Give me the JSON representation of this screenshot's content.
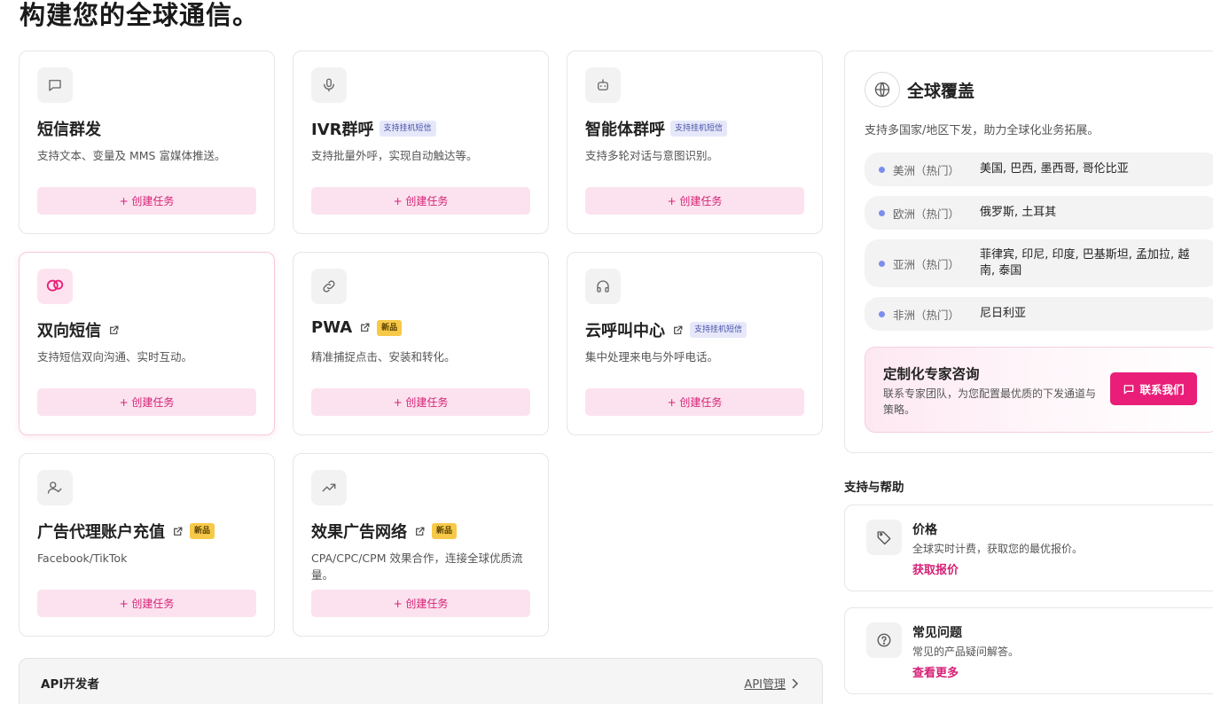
{
  "page": {
    "title": "构建您的全球通信。"
  },
  "colors": {
    "accent": "#e91e78",
    "accent_soft": "#fce2ee",
    "tag_blue_bg": "#e6e8fa",
    "tag_yellow_bg": "#f7c948",
    "region_dot": "#7b8ef0"
  },
  "services": [
    {
      "title": "短信群发",
      "icon": "chat-bubble-icon",
      "tag": "",
      "external": false,
      "desc": "支持文本、变量及 MMS 富媒体推送。",
      "button": "+ 创建任务"
    },
    {
      "title": "IVR群呼",
      "icon": "microphone-icon",
      "tag": "支持挂机短信",
      "external": false,
      "desc": "支持批量外呼，实现自动触达等。",
      "button": "+ 创建任务"
    },
    {
      "title": "智能体群呼",
      "icon": "robot-icon",
      "tag": "支持挂机短信",
      "external": false,
      "desc": "支持多轮对话与意图识别。",
      "button": "+ 创建任务"
    },
    {
      "title": "双向短信",
      "icon": "two-way-chat-icon",
      "tag": "",
      "external": true,
      "desc": "支持短信双向沟通、实时互动。",
      "button": "+ 创建任务"
    },
    {
      "title": "PWA",
      "icon": "link-icon",
      "tag": "新品",
      "external": true,
      "desc": "精准捕捉点击、安装和转化。",
      "button": "+ 创建任务"
    },
    {
      "title": "云呼叫中心",
      "icon": "headset-icon",
      "tag": "支持挂机短信",
      "external": true,
      "desc": "集中处理来电与外呼电话。",
      "button": "+ 创建任务"
    },
    {
      "title": "广告代理账户充值",
      "icon": "user-check-icon",
      "tag": "新品",
      "external": true,
      "desc": "Facebook/TikTok",
      "button": "+ 创建任务"
    },
    {
      "title": "效果广告网络",
      "icon": "trending-up-icon",
      "tag": "新品",
      "external": true,
      "desc": "CPA/CPC/CPM 效果合作，连接全球优质流量。",
      "button": "+ 创建任务"
    }
  ],
  "api": {
    "title": "API开发者",
    "link": "API管理"
  },
  "coverage": {
    "title": "全球覆盖",
    "subtitle": "支持多国家/地区下发，助力全球化业务拓展。",
    "regions": [
      {
        "name": "美洲（热门）",
        "countries": "美国, 巴西, 墨西哥, 哥伦比亚"
      },
      {
        "name": "欧洲（热门）",
        "countries": "俄罗斯, 土耳其"
      },
      {
        "name": "亚洲（热门）",
        "countries": "菲律宾, 印尼, 印度, 巴基斯坦, 孟加拉, 越南, 泰国"
      },
      {
        "name": "非洲（热门）",
        "countries": "尼日利亚"
      }
    ],
    "consult": {
      "title": "定制化专家咨询",
      "desc": "联系专家团队，为您配置最优质的下发通道与策略。",
      "button": "联系我们"
    }
  },
  "help": {
    "heading": "支持与帮助",
    "items": [
      {
        "title": "价格",
        "desc": "全球实时计费，获取您的最优报价。",
        "link": "获取报价",
        "icon": "price-tag-icon"
      },
      {
        "title": "常见问题",
        "desc": "常见的产品疑问解答。",
        "link": "查看更多",
        "icon": "question-circle-icon"
      }
    ]
  }
}
